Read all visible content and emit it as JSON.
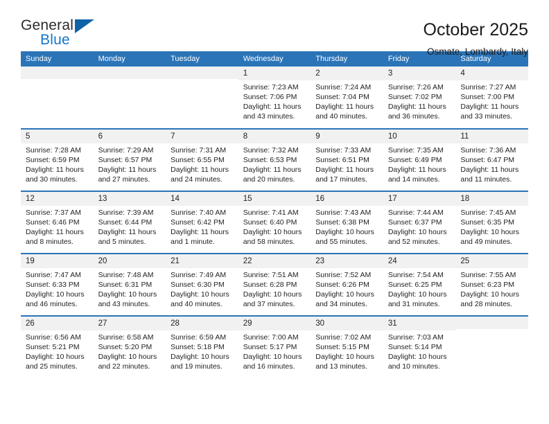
{
  "brand": {
    "name_top": "General",
    "name_bottom": "Blue",
    "flag_icon": "triangle-flag-icon"
  },
  "header": {
    "title": "October 2025",
    "location": "Osmate, Lombardy, Italy"
  },
  "colors": {
    "header_blue": "#2b74b8",
    "brand_blue": "#1477c9",
    "daynum_bg": "#f1f1f1"
  },
  "calendar": {
    "weekday_headers": [
      "Sunday",
      "Monday",
      "Tuesday",
      "Wednesday",
      "Thursday",
      "Friday",
      "Saturday"
    ],
    "labels": {
      "sunrise": "Sunrise:",
      "sunset": "Sunset:",
      "daylight": "Daylight:"
    },
    "weeks": [
      [
        {
          "day": "",
          "empty": true
        },
        {
          "day": "",
          "empty": true
        },
        {
          "day": "",
          "empty": true
        },
        {
          "day": "1",
          "sunrise": "Sunrise: 7:23 AM",
          "sunset": "Sunset: 7:06 PM",
          "daylight_1": "Daylight: 11 hours",
          "daylight_2": "and 43 minutes."
        },
        {
          "day": "2",
          "sunrise": "Sunrise: 7:24 AM",
          "sunset": "Sunset: 7:04 PM",
          "daylight_1": "Daylight: 11 hours",
          "daylight_2": "and 40 minutes."
        },
        {
          "day": "3",
          "sunrise": "Sunrise: 7:26 AM",
          "sunset": "Sunset: 7:02 PM",
          "daylight_1": "Daylight: 11 hours",
          "daylight_2": "and 36 minutes."
        },
        {
          "day": "4",
          "sunrise": "Sunrise: 7:27 AM",
          "sunset": "Sunset: 7:00 PM",
          "daylight_1": "Daylight: 11 hours",
          "daylight_2": "and 33 minutes."
        }
      ],
      [
        {
          "day": "5",
          "sunrise": "Sunrise: 7:28 AM",
          "sunset": "Sunset: 6:59 PM",
          "daylight_1": "Daylight: 11 hours",
          "daylight_2": "and 30 minutes."
        },
        {
          "day": "6",
          "sunrise": "Sunrise: 7:29 AM",
          "sunset": "Sunset: 6:57 PM",
          "daylight_1": "Daylight: 11 hours",
          "daylight_2": "and 27 minutes."
        },
        {
          "day": "7",
          "sunrise": "Sunrise: 7:31 AM",
          "sunset": "Sunset: 6:55 PM",
          "daylight_1": "Daylight: 11 hours",
          "daylight_2": "and 24 minutes."
        },
        {
          "day": "8",
          "sunrise": "Sunrise: 7:32 AM",
          "sunset": "Sunset: 6:53 PM",
          "daylight_1": "Daylight: 11 hours",
          "daylight_2": "and 20 minutes."
        },
        {
          "day": "9",
          "sunrise": "Sunrise: 7:33 AM",
          "sunset": "Sunset: 6:51 PM",
          "daylight_1": "Daylight: 11 hours",
          "daylight_2": "and 17 minutes."
        },
        {
          "day": "10",
          "sunrise": "Sunrise: 7:35 AM",
          "sunset": "Sunset: 6:49 PM",
          "daylight_1": "Daylight: 11 hours",
          "daylight_2": "and 14 minutes."
        },
        {
          "day": "11",
          "sunrise": "Sunrise: 7:36 AM",
          "sunset": "Sunset: 6:47 PM",
          "daylight_1": "Daylight: 11 hours",
          "daylight_2": "and 11 minutes."
        }
      ],
      [
        {
          "day": "12",
          "sunrise": "Sunrise: 7:37 AM",
          "sunset": "Sunset: 6:46 PM",
          "daylight_1": "Daylight: 11 hours",
          "daylight_2": "and 8 minutes."
        },
        {
          "day": "13",
          "sunrise": "Sunrise: 7:39 AM",
          "sunset": "Sunset: 6:44 PM",
          "daylight_1": "Daylight: 11 hours",
          "daylight_2": "and 5 minutes."
        },
        {
          "day": "14",
          "sunrise": "Sunrise: 7:40 AM",
          "sunset": "Sunset: 6:42 PM",
          "daylight_1": "Daylight: 11 hours",
          "daylight_2": "and 1 minute."
        },
        {
          "day": "15",
          "sunrise": "Sunrise: 7:41 AM",
          "sunset": "Sunset: 6:40 PM",
          "daylight_1": "Daylight: 10 hours",
          "daylight_2": "and 58 minutes."
        },
        {
          "day": "16",
          "sunrise": "Sunrise: 7:43 AM",
          "sunset": "Sunset: 6:38 PM",
          "daylight_1": "Daylight: 10 hours",
          "daylight_2": "and 55 minutes."
        },
        {
          "day": "17",
          "sunrise": "Sunrise: 7:44 AM",
          "sunset": "Sunset: 6:37 PM",
          "daylight_1": "Daylight: 10 hours",
          "daylight_2": "and 52 minutes."
        },
        {
          "day": "18",
          "sunrise": "Sunrise: 7:45 AM",
          "sunset": "Sunset: 6:35 PM",
          "daylight_1": "Daylight: 10 hours",
          "daylight_2": "and 49 minutes."
        }
      ],
      [
        {
          "day": "19",
          "sunrise": "Sunrise: 7:47 AM",
          "sunset": "Sunset: 6:33 PM",
          "daylight_1": "Daylight: 10 hours",
          "daylight_2": "and 46 minutes."
        },
        {
          "day": "20",
          "sunrise": "Sunrise: 7:48 AM",
          "sunset": "Sunset: 6:31 PM",
          "daylight_1": "Daylight: 10 hours",
          "daylight_2": "and 43 minutes."
        },
        {
          "day": "21",
          "sunrise": "Sunrise: 7:49 AM",
          "sunset": "Sunset: 6:30 PM",
          "daylight_1": "Daylight: 10 hours",
          "daylight_2": "and 40 minutes."
        },
        {
          "day": "22",
          "sunrise": "Sunrise: 7:51 AM",
          "sunset": "Sunset: 6:28 PM",
          "daylight_1": "Daylight: 10 hours",
          "daylight_2": "and 37 minutes."
        },
        {
          "day": "23",
          "sunrise": "Sunrise: 7:52 AM",
          "sunset": "Sunset: 6:26 PM",
          "daylight_1": "Daylight: 10 hours",
          "daylight_2": "and 34 minutes."
        },
        {
          "day": "24",
          "sunrise": "Sunrise: 7:54 AM",
          "sunset": "Sunset: 6:25 PM",
          "daylight_1": "Daylight: 10 hours",
          "daylight_2": "and 31 minutes."
        },
        {
          "day": "25",
          "sunrise": "Sunrise: 7:55 AM",
          "sunset": "Sunset: 6:23 PM",
          "daylight_1": "Daylight: 10 hours",
          "daylight_2": "and 28 minutes."
        }
      ],
      [
        {
          "day": "26",
          "sunrise": "Sunrise: 6:56 AM",
          "sunset": "Sunset: 5:21 PM",
          "daylight_1": "Daylight: 10 hours",
          "daylight_2": "and 25 minutes."
        },
        {
          "day": "27",
          "sunrise": "Sunrise: 6:58 AM",
          "sunset": "Sunset: 5:20 PM",
          "daylight_1": "Daylight: 10 hours",
          "daylight_2": "and 22 minutes."
        },
        {
          "day": "28",
          "sunrise": "Sunrise: 6:59 AM",
          "sunset": "Sunset: 5:18 PM",
          "daylight_1": "Daylight: 10 hours",
          "daylight_2": "and 19 minutes."
        },
        {
          "day": "29",
          "sunrise": "Sunrise: 7:00 AM",
          "sunset": "Sunset: 5:17 PM",
          "daylight_1": "Daylight: 10 hours",
          "daylight_2": "and 16 minutes."
        },
        {
          "day": "30",
          "sunrise": "Sunrise: 7:02 AM",
          "sunset": "Sunset: 5:15 PM",
          "daylight_1": "Daylight: 10 hours",
          "daylight_2": "and 13 minutes."
        },
        {
          "day": "31",
          "sunrise": "Sunrise: 7:03 AM",
          "sunset": "Sunset: 5:14 PM",
          "daylight_1": "Daylight: 10 hours",
          "daylight_2": "and 10 minutes."
        },
        {
          "day": "",
          "empty": true
        }
      ]
    ]
  }
}
